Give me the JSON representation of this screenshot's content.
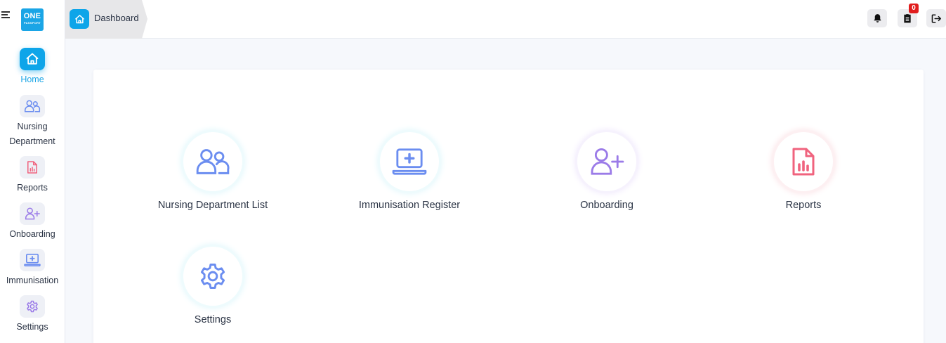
{
  "brand": {
    "logo_big": "ONE",
    "logo_small": "PASSPORT"
  },
  "sidebar": {
    "items": [
      {
        "label": "Home",
        "icon": "home-icon",
        "active": true
      },
      {
        "label": "Nursing Department",
        "icon": "users-icon"
      },
      {
        "label": "Reports",
        "icon": "report-icon"
      },
      {
        "label": "Onboarding",
        "icon": "user-plus-icon"
      },
      {
        "label": "Immunisation",
        "icon": "laptop-medical-icon"
      },
      {
        "label": "Settings",
        "icon": "gear-icon"
      }
    ]
  },
  "header": {
    "breadcrumb": "Dashboard",
    "notifications_icon": "bell-icon",
    "clipboard_icon": "clipboard-icon",
    "clipboard_count": "0",
    "logout_icon": "logout-icon"
  },
  "dashboard": {
    "tiles": [
      {
        "label": "Nursing Department List",
        "icon": "users-icon"
      },
      {
        "label": "Immunisation Register",
        "icon": "laptop-medical-icon"
      },
      {
        "label": "Onboarding",
        "icon": "user-plus-icon"
      },
      {
        "label": "Reports",
        "icon": "report-icon"
      },
      {
        "label": "Settings",
        "icon": "gear-icon"
      }
    ]
  },
  "colors": {
    "accent": "#0ea5e9",
    "blue_icon": "#6b8df0",
    "purple_icon": "#9b7be8",
    "pink_icon": "#f0637e",
    "badge": "#e11d1d"
  }
}
